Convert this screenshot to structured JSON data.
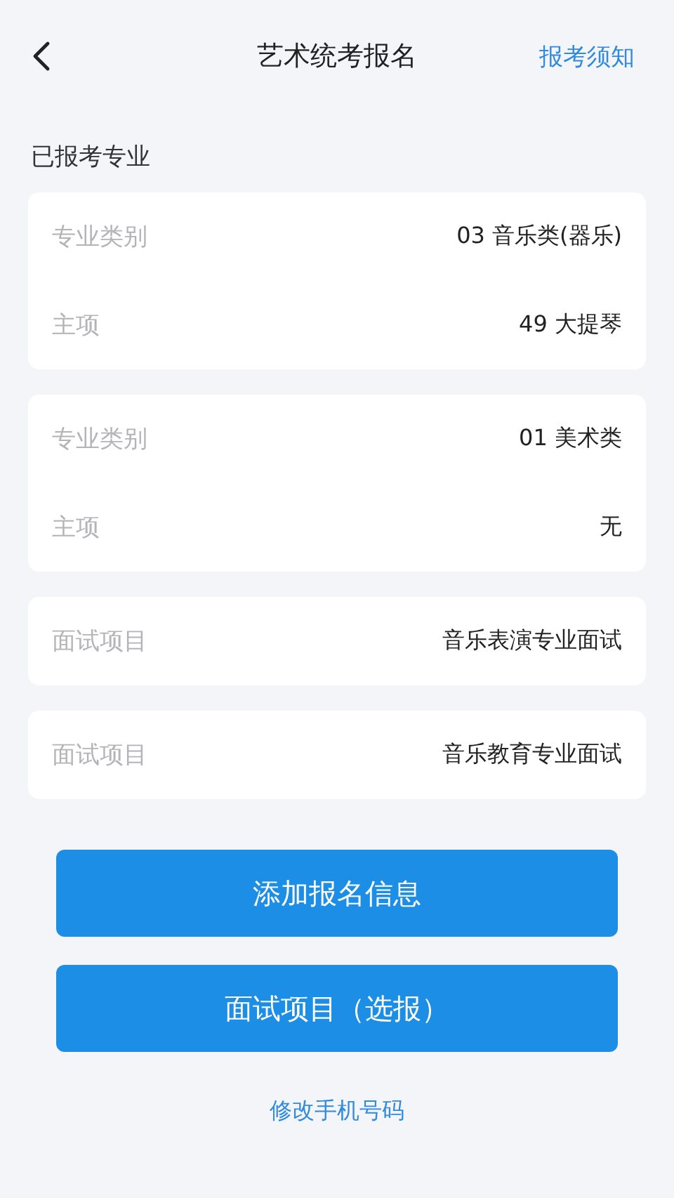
{
  "header": {
    "title": "艺术统考报名",
    "action": "报考须知"
  },
  "section_title": "已报考专业",
  "cards": [
    {
      "rows": [
        {
          "label": "专业类别",
          "value": "03 音乐类(器乐)"
        },
        {
          "label": "主项",
          "value": "49 大提琴"
        }
      ]
    },
    {
      "rows": [
        {
          "label": "专业类别",
          "value": "01 美术类"
        },
        {
          "label": "主项",
          "value": "无"
        }
      ]
    },
    {
      "rows": [
        {
          "label": "面试项目",
          "value": "音乐表演专业面试"
        }
      ]
    },
    {
      "rows": [
        {
          "label": "面试项目",
          "value": "音乐教育专业面试"
        }
      ]
    }
  ],
  "buttons": [
    "添加报名信息",
    "面试项目（选报）"
  ],
  "link": "修改手机号码"
}
